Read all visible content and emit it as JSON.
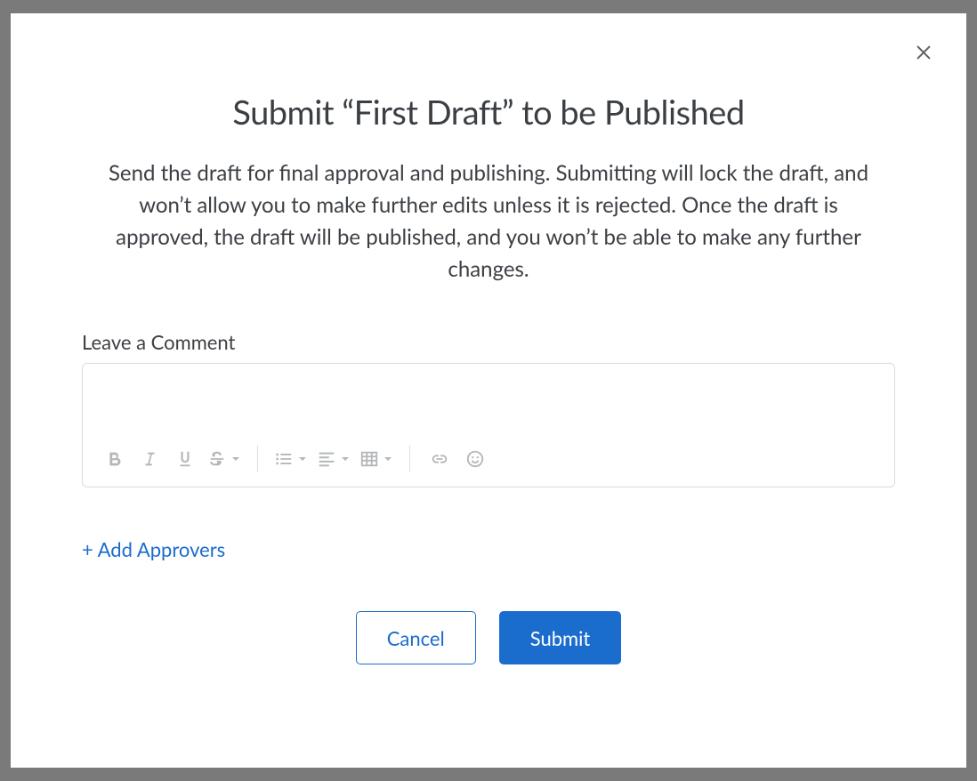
{
  "dialog": {
    "title_prefix": "Submit “",
    "title_name": "First Draft",
    "title_suffix": "” to be Published",
    "description": "Send the draft for final approval and publishing. Submitting will lock the draft, and won’t allow you to make further edits unless it is rejected. Once the draft is approved, the draft will be published, and you won’t be able to make any further changes.",
    "comment_label": "Leave a Comment",
    "comment_value": "",
    "add_approvers_label": "+ Add Approvers",
    "cancel_label": "Cancel",
    "submit_label": "Submit"
  },
  "toolbar": {
    "bold": "Bold",
    "italic": "Italic",
    "underline": "Underline",
    "strike": "Strikethrough",
    "list": "List",
    "align": "Align",
    "table": "Table",
    "link": "Link",
    "emoji": "Emoji"
  }
}
